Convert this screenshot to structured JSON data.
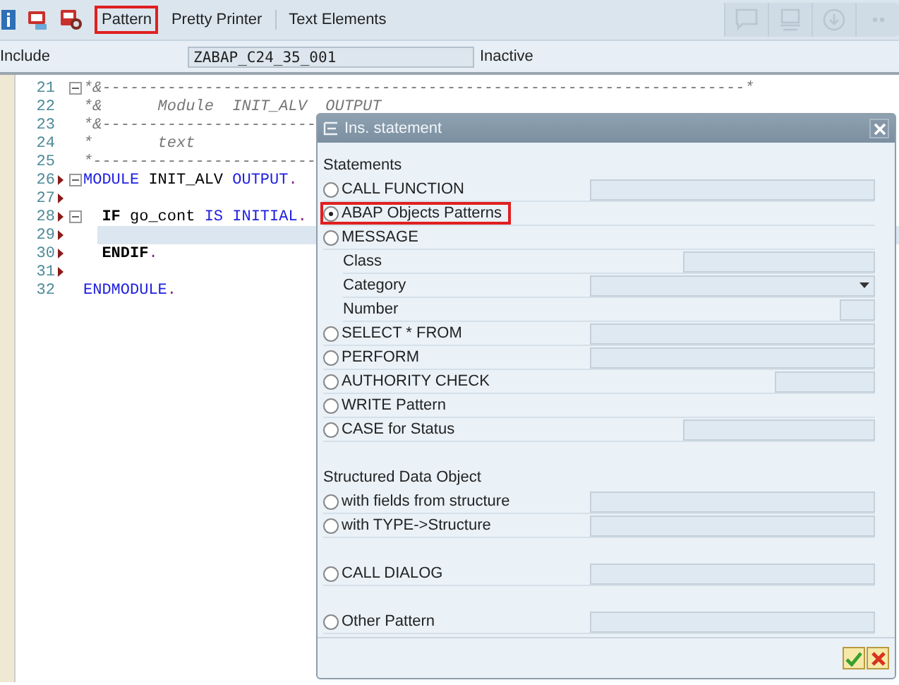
{
  "toolbar": {
    "buttons": [
      {
        "label": "Pattern",
        "highlighted": true
      },
      {
        "label": "Pretty Printer",
        "highlighted": false
      },
      {
        "label": "Text Elements",
        "highlighted": false
      }
    ]
  },
  "header": {
    "label": "Include",
    "value": "ZABAP_C24_35_001",
    "status": "Inactive"
  },
  "editor": {
    "lines": [
      {
        "number": "21",
        "fold": true,
        "marker": false,
        "current": false,
        "tokens": [
          {
            "kind": "comment",
            "text": "*&---------------------------------------------------------------------*"
          }
        ]
      },
      {
        "number": "22",
        "fold": false,
        "marker": false,
        "current": false,
        "tokens": [
          {
            "kind": "comment",
            "text": "*&      Module  INIT_ALV  OUTPUT"
          }
        ]
      },
      {
        "number": "23",
        "fold": false,
        "marker": false,
        "current": false,
        "tokens": [
          {
            "kind": "comment",
            "text": "*&-----------------------"
          }
        ]
      },
      {
        "number": "24",
        "fold": false,
        "marker": false,
        "current": false,
        "tokens": [
          {
            "kind": "comment",
            "text": "*       text"
          }
        ]
      },
      {
        "number": "25",
        "fold": false,
        "marker": false,
        "current": false,
        "tokens": [
          {
            "kind": "comment",
            "text": "*------------------------"
          }
        ]
      },
      {
        "number": "26",
        "fold": true,
        "marker": true,
        "current": false,
        "tokens": [
          {
            "kind": "keyword",
            "text": "MODULE"
          },
          {
            "kind": "plain",
            "text": " INIT_ALV "
          },
          {
            "kind": "keyword",
            "text": "OUTPUT"
          },
          {
            "kind": "punct",
            "text": "."
          }
        ]
      },
      {
        "number": "27",
        "fold": false,
        "marker": true,
        "current": false
      },
      {
        "number": "28",
        "fold": true,
        "marker": true,
        "current": false,
        "tokens": [
          {
            "kind": "statement",
            "text": "  IF"
          },
          {
            "kind": "plain",
            "text": " go_cont "
          },
          {
            "kind": "keyword",
            "text": "IS INITIAL"
          },
          {
            "kind": "punct",
            "text": "."
          }
        ]
      },
      {
        "number": "29",
        "fold": false,
        "marker": true,
        "current": true
      },
      {
        "number": "30",
        "fold": false,
        "marker": true,
        "current": false,
        "tokens": [
          {
            "kind": "statement",
            "text": "  ENDIF"
          },
          {
            "kind": "punct",
            "text": "."
          }
        ]
      },
      {
        "number": "31",
        "fold": false,
        "marker": true,
        "current": false
      },
      {
        "number": "32",
        "fold": false,
        "marker": false,
        "current": false,
        "tokens": [
          {
            "kind": "keyword",
            "text": "ENDMODULE"
          },
          {
            "kind": "punct",
            "text": "."
          }
        ]
      }
    ]
  },
  "dialog": {
    "title": "Ins. statement",
    "sections": [
      {
        "heading": "Statements",
        "rows": [
          {
            "kind": "radio",
            "label": "CALL FUNCTION",
            "selected": false,
            "highlighted": false,
            "field": {
              "kind": "long-text"
            }
          },
          {
            "kind": "radio",
            "label": "ABAP Objects Patterns",
            "selected": true,
            "highlighted": true
          },
          {
            "kind": "radio",
            "label": "MESSAGE",
            "selected": false,
            "highlighted": false
          },
          {
            "kind": "label",
            "label": "Class",
            "field": {
              "kind": "medium-text"
            }
          },
          {
            "kind": "label",
            "label": "Category",
            "field": {
              "kind": "dropdown"
            }
          },
          {
            "kind": "label",
            "label": "Number",
            "field": {
              "kind": "tiny-text"
            }
          },
          {
            "kind": "radio",
            "label": "SELECT * FROM",
            "selected": false,
            "highlighted": false,
            "field": {
              "kind": "long-text"
            }
          },
          {
            "kind": "radio",
            "label": "PERFORM",
            "selected": false,
            "highlighted": false,
            "field": {
              "kind": "long-text"
            }
          },
          {
            "kind": "radio",
            "label": "AUTHORITY CHECK",
            "selected": false,
            "highlighted": false,
            "field": {
              "kind": "short-text"
            }
          },
          {
            "kind": "radio",
            "label": "WRITE Pattern",
            "selected": false,
            "highlighted": false
          },
          {
            "kind": "radio",
            "label": "CASE for Status",
            "selected": false,
            "highlighted": false,
            "field": {
              "kind": "medium-text"
            }
          }
        ]
      },
      {
        "heading": "Structured Data Object",
        "rows": [
          {
            "kind": "radio",
            "label": "with fields from structure",
            "selected": false,
            "highlighted": false,
            "field": {
              "kind": "long-text"
            }
          },
          {
            "kind": "radio",
            "label": "with TYPE->Structure",
            "selected": false,
            "highlighted": false,
            "field": {
              "kind": "long-text"
            }
          }
        ]
      },
      {
        "rows": [
          {
            "kind": "radio",
            "label": "CALL DIALOG",
            "selected": false,
            "highlighted": false,
            "field": {
              "kind": "long-text"
            }
          }
        ]
      },
      {
        "rows": [
          {
            "kind": "radio",
            "label": "Other Pattern",
            "selected": false,
            "highlighted": false,
            "field": {
              "kind": "long-text"
            }
          }
        ]
      }
    ]
  }
}
